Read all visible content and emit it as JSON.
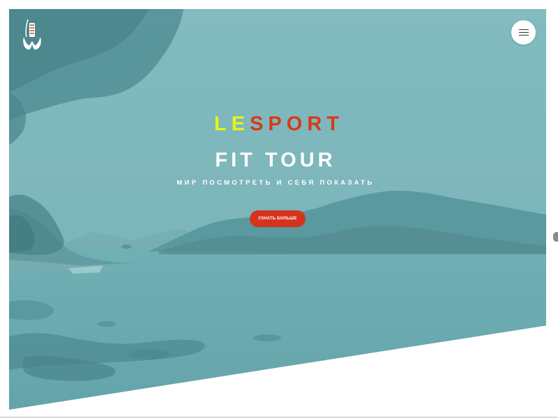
{
  "brand": {
    "title_part1": "LE",
    "title_part2": "SPORT",
    "subtitle": "FIT TOUR",
    "tagline": "МИР ПОСМОТРЕТЬ И СЕБЯ ПОКАЗАТЬ",
    "colors": {
      "title_part1": "#eaf21a",
      "title_part2": "#d93a16",
      "cta_background": "#d5331b",
      "hero_overlay": "#6daeb4"
    }
  },
  "cta": {
    "label": "УЗНАТЬ БОЛЬШЕ"
  },
  "icons": {
    "logo": "lesport-logo-icon",
    "menu": "hamburger-menu-icon"
  }
}
